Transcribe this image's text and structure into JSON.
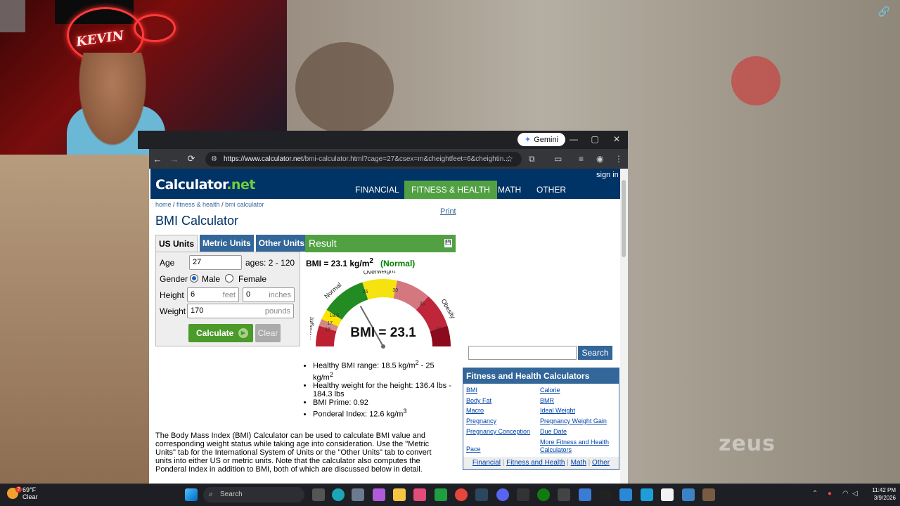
{
  "browser": {
    "gemini_label": "Gemini",
    "url_host": "https://www.calculator.net",
    "url_path": "/bmi-calculator.html?cage=27&csex=m&cheightfeet=6&cheightin..."
  },
  "site": {
    "logo_main": "Calculator",
    "logo_suffix": ".net",
    "sign_in": "sign in",
    "menu": [
      "FINANCIAL",
      "FITNESS & HEALTH",
      "MATH",
      "OTHER"
    ],
    "breadcrumb": [
      "home",
      "fitness & health",
      "bmi calculator"
    ],
    "print": "Print",
    "title": "BMI Calculator"
  },
  "form": {
    "tabs": [
      "US Units",
      "Metric Units",
      "Other Units"
    ],
    "age_label": "Age",
    "age_value": "27",
    "age_hint": "ages: 2 - 120",
    "gender_label": "Gender",
    "male": "Male",
    "female": "Female",
    "height_label": "Height",
    "height_feet": "6",
    "feet_unit": "feet",
    "height_inches": "0",
    "inches_unit": "inches",
    "weight_label": "Weight",
    "weight_value": "170",
    "pounds_unit": "pounds",
    "calculate": "Calculate",
    "clear": "Clear"
  },
  "result": {
    "header": "Result",
    "bmi_prefix": "BMI = 23.1 kg/m",
    "bmi_sup": "2",
    "status": "(Normal)",
    "gauge_value": "BMI = 23.1",
    "gauge_labels": [
      "Underweight",
      "Normal",
      "Overweight",
      "Obesity"
    ],
    "gauge_ticks": [
      "16",
      "17",
      "18.5",
      "25",
      "30",
      "35",
      "40"
    ],
    "bmi_number": 23.1,
    "bullets": [
      {
        "text": "Healthy BMI range: 18.5 kg/m",
        "sup": "2",
        "tail": " - 25 kg/m",
        "sup2": "2"
      },
      {
        "text": "Healthy weight for the height: 136.4 lbs - 184.3 lbs"
      },
      {
        "text": "BMI Prime: 0.92"
      },
      {
        "text": "Ponderal Index: 12.6 kg/m",
        "sup": "3"
      }
    ],
    "colors": {
      "underweight": "#bd2031",
      "normal": "#228b22",
      "overweight": "#f4e30e",
      "obese1": "#d4777f",
      "obese2": "#c0263a",
      "obese3": "#8b0a1b"
    }
  },
  "description": "The Body Mass Index (BMI) Calculator can be used to calculate BMI value and corresponding weight status while taking age into consideration. Use the \"Metric Units\" tab for the International System of Units or the \"Other Units\" tab to convert units into either US or metric units. Note that the calculator also computes the Ponderal Index in addition to BMI, both of which are discussed below in detail.",
  "sidebar": {
    "search_button": "Search",
    "box_title": "Fitness and Health Calculators",
    "links_left": [
      "BMI",
      "Body Fat",
      "Macro",
      "Pregnancy",
      "Pregnancy Conception",
      "Pace"
    ],
    "links_right": [
      "Calorie",
      "BMR",
      "Ideal Weight",
      "Pregnancy Weight Gain",
      "Due Date",
      "More Fitness and Health Calculators"
    ],
    "footer_links": [
      "Financial",
      "Fitness and Health",
      "Math",
      "Other"
    ]
  },
  "overlay": {
    "neon_text": "KEVIN",
    "watermark": "zeus"
  },
  "taskbar": {
    "temp": "69°F",
    "condition": "Clear",
    "weather_badge": "2",
    "search_placeholder": "Search",
    "time": "11:42 PM",
    "date": "3/9/2026"
  }
}
